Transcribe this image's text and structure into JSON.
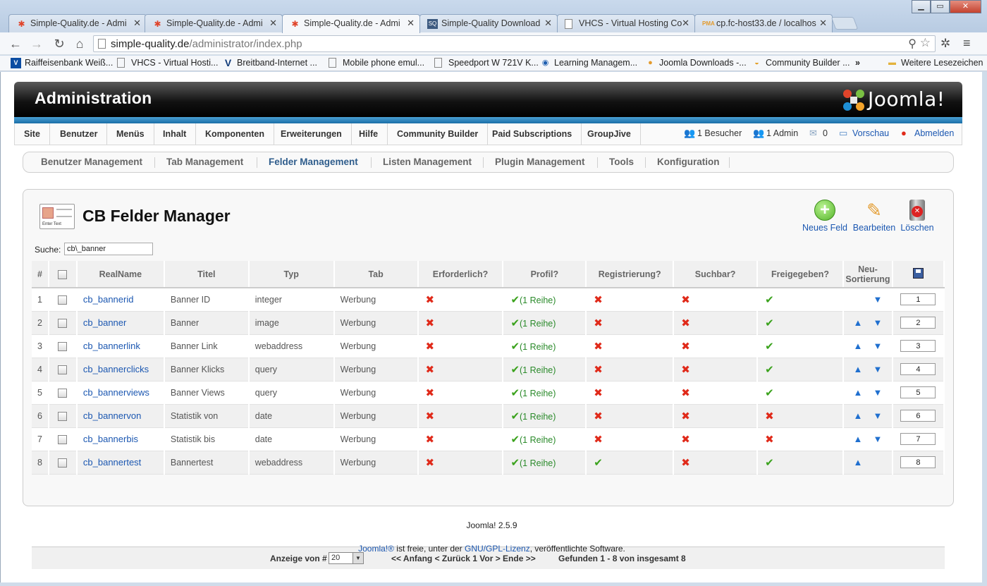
{
  "browser": {
    "tabs": [
      {
        "title": "Simple-Quality.de - Admi",
        "icon": "joomla-icon",
        "active": false
      },
      {
        "title": "Simple-Quality.de - Admi",
        "icon": "joomla-icon",
        "active": false
      },
      {
        "title": "Simple-Quality.de - Admi",
        "icon": "joomla-icon",
        "active": true
      },
      {
        "title": "Simple-Quality Download",
        "icon": "so-icon",
        "active": false
      },
      {
        "title": "VHCS - Virtual Hosting Co",
        "icon": "page-icon",
        "active": false
      },
      {
        "title": "cp.fc-host33.de / localhos",
        "icon": "pma-icon",
        "active": false
      }
    ],
    "url_host": "simple-quality.de",
    "url_path": "/administrator/index.php",
    "bookmarks": [
      {
        "label": "Raiffeisenbank Weiß...",
        "icon": "vr-bank-icon"
      },
      {
        "label": "VHCS - Virtual Hosti...",
        "icon": "page-icon"
      },
      {
        "label": "Breitband-Internet ...",
        "icon": "v-logo-icon"
      },
      {
        "label": "Mobile phone emul...",
        "icon": "page-icon"
      },
      {
        "label": "Speedport W 721V K...",
        "icon": "page-icon"
      },
      {
        "label": "Learning Managem...",
        "icon": "globe-icon"
      },
      {
        "label": "Joomla Downloads -...",
        "icon": "joomla-icon"
      },
      {
        "label": "Community Builder ...",
        "icon": "cb-icon"
      }
    ],
    "bookmarks_overflow": "»",
    "other_bookmarks": "Weitere Lesezeichen"
  },
  "admin": {
    "header_title": "Administration",
    "logo_text": "Joomla!",
    "menu": [
      "Site",
      "Benutzer",
      "Menüs",
      "Inhalt",
      "Komponenten",
      "Erweiterungen",
      "Hilfe",
      "Community Builder",
      "Paid Subscriptions",
      "GroupJive"
    ],
    "status": {
      "visitors": "1 Besucher",
      "admins": "1 Admin",
      "messages": "0",
      "preview": "Vorschau",
      "logout": "Abmelden"
    },
    "submenu": [
      "Benutzer Management",
      "Tab Management",
      "Felder Management",
      "Listen Management",
      "Plugin Management",
      "Tools",
      "Konfiguration"
    ],
    "submenu_active": "Felder Management"
  },
  "page": {
    "title": "CB Felder Manager",
    "icon_text": "Enter Text",
    "toolbar": {
      "new": "Neues Feld",
      "edit": "Bearbeiten",
      "delete": "Löschen"
    },
    "search_label": "Suche:",
    "search_value": "cb\\_banner",
    "columns": [
      "#",
      "",
      "RealName",
      "Titel",
      "Typ",
      "Tab",
      "Erforderlich?",
      "Profil?",
      "Registrierung?",
      "Suchbar?",
      "Freigegeben?",
      "Neu-Sortierung",
      ""
    ],
    "rows": [
      {
        "num": "1",
        "realname": "cb_bannerid",
        "titel": "Banner ID",
        "typ": "integer",
        "tab": "Werbung",
        "required": false,
        "profile": "(1 Reihe)",
        "registration": false,
        "searchable": false,
        "published": true,
        "up": false,
        "down": true,
        "order": "1"
      },
      {
        "num": "2",
        "realname": "cb_banner",
        "titel": "Banner",
        "typ": "image",
        "tab": "Werbung",
        "required": false,
        "profile": "(1 Reihe)",
        "registration": false,
        "searchable": false,
        "published": true,
        "up": true,
        "down": true,
        "order": "2"
      },
      {
        "num": "3",
        "realname": "cb_bannerlink",
        "titel": "Banner Link",
        "typ": "webaddress",
        "tab": "Werbung",
        "required": false,
        "profile": "(1 Reihe)",
        "registration": false,
        "searchable": false,
        "published": true,
        "up": true,
        "down": true,
        "order": "3"
      },
      {
        "num": "4",
        "realname": "cb_bannerclicks",
        "titel": "Banner Klicks",
        "typ": "query",
        "tab": "Werbung",
        "required": false,
        "profile": "(1 Reihe)",
        "registration": false,
        "searchable": false,
        "published": true,
        "up": true,
        "down": true,
        "order": "4"
      },
      {
        "num": "5",
        "realname": "cb_bannerviews",
        "titel": "Banner Views",
        "typ": "query",
        "tab": "Werbung",
        "required": false,
        "profile": "(1 Reihe)",
        "registration": false,
        "searchable": false,
        "published": true,
        "up": true,
        "down": true,
        "order": "5"
      },
      {
        "num": "6",
        "realname": "cb_bannervon",
        "titel": "Statistik von",
        "typ": "date",
        "tab": "Werbung",
        "required": false,
        "profile": "(1 Reihe)",
        "registration": false,
        "searchable": false,
        "published": false,
        "up": true,
        "down": true,
        "order": "6"
      },
      {
        "num": "7",
        "realname": "cb_bannerbis",
        "titel": "Statistik bis",
        "typ": "date",
        "tab": "Werbung",
        "required": false,
        "profile": "(1 Reihe)",
        "registration": false,
        "searchable": false,
        "published": false,
        "up": true,
        "down": true,
        "order": "7"
      },
      {
        "num": "8",
        "realname": "cb_bannertest",
        "titel": "Bannertest",
        "typ": "webaddress",
        "tab": "Werbung",
        "required": false,
        "profile": "(1 Reihe)",
        "registration": true,
        "searchable": false,
        "published": true,
        "up": true,
        "down": false,
        "order": "8"
      }
    ],
    "pagination": {
      "label": "Anzeige von #",
      "limit": "20",
      "nav": "<< Anfang < Zurück 1 Vor > Ende >>",
      "found_prefix": "Gefunden ",
      "found_range": "1",
      "found_suffix": " - 8 von insgesamt 8"
    }
  },
  "footer": {
    "version": "Joomla! 2.5.9",
    "joomla_link": "Joomla!®",
    "text1": " ist freie, unter der ",
    "gpl_link": "GNU/GPL-Lizenz",
    "text2": ", veröffentlichte Software."
  },
  "colors": {
    "accent_blue": "#1b57b1",
    "stripe": "#1a6ea8",
    "cross_red": "#e02a1a",
    "tick_green": "#3aa21c"
  }
}
